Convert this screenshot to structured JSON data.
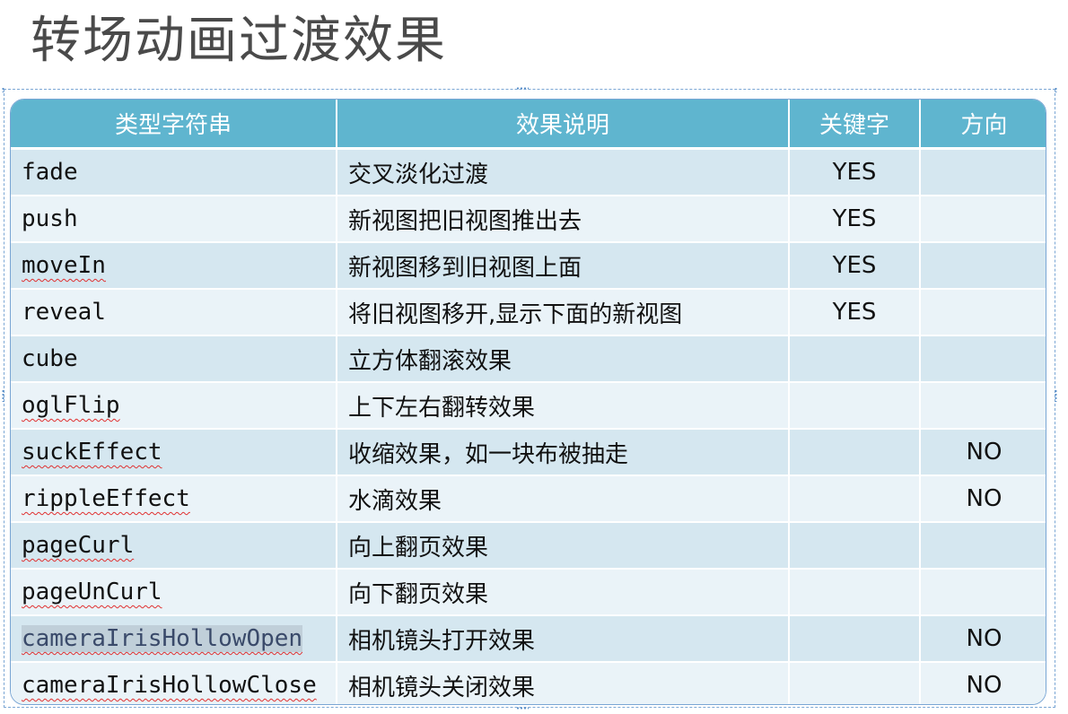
{
  "title": "转场动画过渡效果",
  "table": {
    "headers": [
      "类型字符串",
      "效果说明",
      "关键字",
      "方向"
    ],
    "rows": [
      {
        "type": "fade",
        "desc": "交叉淡化过渡",
        "keyword": "YES",
        "direction": "",
        "squiggle": false,
        "selected": false
      },
      {
        "type": "push",
        "desc": "新视图把旧视图推出去",
        "keyword": "YES",
        "direction": "",
        "squiggle": false,
        "selected": false
      },
      {
        "type": "moveIn",
        "desc": "新视图移到旧视图上面",
        "keyword": "YES",
        "direction": "",
        "squiggle": true,
        "selected": false
      },
      {
        "type": "reveal",
        "desc": "将旧视图移开,显示下面的新视图",
        "keyword": "YES",
        "direction": "",
        "squiggle": false,
        "selected": false
      },
      {
        "type": "cube",
        "desc": "立方体翻滚效果",
        "keyword": "",
        "direction": "",
        "squiggle": false,
        "selected": false
      },
      {
        "type": "oglFlip",
        "desc": "上下左右翻转效果",
        "keyword": "",
        "direction": "",
        "squiggle": true,
        "selected": false
      },
      {
        "type": "suckEffect",
        "desc": "收缩效果，如一块布被抽走",
        "keyword": "",
        "direction": "NO",
        "squiggle": true,
        "selected": false
      },
      {
        "type": "rippleEffect",
        "desc": "水滴效果",
        "keyword": "",
        "direction": "NO",
        "squiggle": true,
        "selected": false
      },
      {
        "type": "pageCurl",
        "desc": "向上翻页效果",
        "keyword": "",
        "direction": "",
        "squiggle": true,
        "selected": false
      },
      {
        "type": "pageUnCurl",
        "desc": "向下翻页效果",
        "keyword": "",
        "direction": "",
        "squiggle": true,
        "selected": false
      },
      {
        "type": "cameraIrisHollowOpen",
        "desc": "相机镜头打开效果",
        "keyword": "",
        "direction": "NO",
        "squiggle": true,
        "selected": true
      },
      {
        "type": "cameraIrisHollowClose",
        "desc": "相机镜头关闭效果",
        "keyword": "",
        "direction": "NO",
        "squiggle": true,
        "selected": false
      }
    ]
  },
  "colors": {
    "header_bg": "#5fb5cf",
    "row_odd": "#d5e7f0",
    "row_even": "#eaf3f8",
    "frame": "#7aa6d4",
    "squiggle": "#e03030"
  }
}
